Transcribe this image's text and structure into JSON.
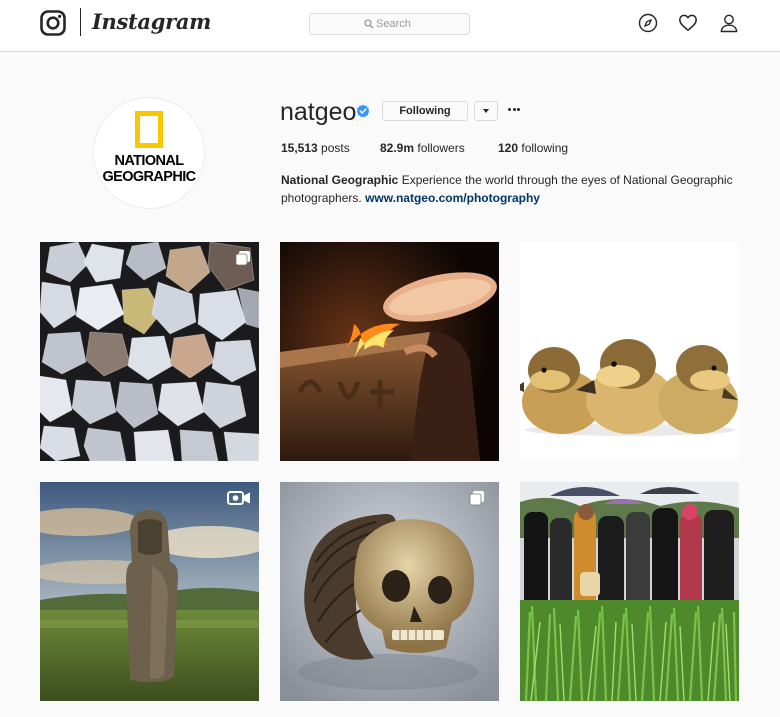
{
  "nav": {
    "wordmark": "Instagram",
    "search_placeholder": "Search",
    "icons": [
      "instagram-logo-icon",
      "search-icon",
      "compass-icon",
      "heart-icon",
      "person-icon"
    ]
  },
  "profile": {
    "username": "natgeo",
    "verified": true,
    "follow_button": "Following",
    "avatar_text": [
      "NATIONAL",
      "GEOGRAPHIC"
    ],
    "stats": {
      "posts_count": "15,513",
      "posts_label": "posts",
      "followers_count": "82.9m",
      "followers_label": "followers",
      "following_count": "120",
      "following_label": "following"
    },
    "bio": {
      "full_name": "National Geographic",
      "text": "Experience the world through the eyes of National Geographic photographers.",
      "link": "www.natgeo.com/photography"
    }
  },
  "colors": {
    "verified_blue": "#3897f0",
    "link_blue": "#003569",
    "natgeo_yellow": "#f7c800",
    "border": "#dbdbdb",
    "background": "#fafafa"
  },
  "posts": [
    {
      "subject": "rough diamonds",
      "badge": "multiple-photos-icon"
    },
    {
      "subject": "fire and stone carving",
      "badge": ""
    },
    {
      "subject": "three ducklings",
      "badge": ""
    },
    {
      "subject": "Easter Island moai",
      "badge": "video-icon"
    },
    {
      "subject": "skull with braided hair",
      "badge": "multiple-photos-icon"
    },
    {
      "subject": "crowd with umbrellas in rice field",
      "badge": ""
    }
  ]
}
